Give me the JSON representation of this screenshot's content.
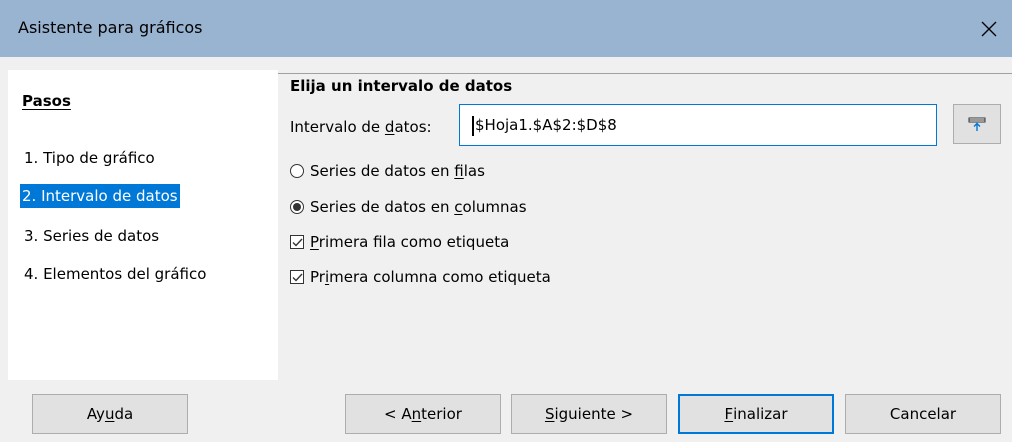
{
  "window": {
    "title": "Asistente para gráficos",
    "close_icon": "close-icon"
  },
  "steps": {
    "heading": "Pasos",
    "items": [
      {
        "label": "1. Tipo de gráfico",
        "selected": false
      },
      {
        "label": "2. Intervalo de datos",
        "selected": true
      },
      {
        "label": "3. Series de datos",
        "selected": false
      },
      {
        "label": "4. Elementos del gráfico",
        "selected": false
      }
    ]
  },
  "main": {
    "section_title": "Elija un intervalo de datos",
    "range_label_pre": "Intervalo de ",
    "range_label_mnemonic": "d",
    "range_label_post": "atos:",
    "range_value": "$Hoja1.$A$2:$D$8",
    "shrink_icon": "shrink-icon",
    "options": [
      {
        "type": "radio",
        "checked": false,
        "pre": "Series de datos en ",
        "mnemonic": "f",
        "post": "ilas"
      },
      {
        "type": "radio",
        "checked": true,
        "pre": "Series de datos en ",
        "mnemonic": "c",
        "post": "olumnas"
      },
      {
        "type": "checkbox",
        "checked": true,
        "pre": "",
        "mnemonic": "P",
        "post": "rimera fila como etiqueta"
      },
      {
        "type": "checkbox",
        "checked": true,
        "pre": "Pr",
        "mnemonic": "i",
        "post": "mera columna como etiqueta"
      }
    ]
  },
  "buttons": {
    "help": {
      "pre": "Ay",
      "mnemonic": "u",
      "post": "da"
    },
    "back": {
      "pre": "< A",
      "mnemonic": "n",
      "post": "terior"
    },
    "next": {
      "pre": "",
      "mnemonic": "S",
      "post": "iguiente >"
    },
    "finish": {
      "pre": "",
      "mnemonic": "F",
      "post": "inalizar"
    },
    "cancel": {
      "pre": "Cancelar",
      "mnemonic": "",
      "post": ""
    }
  },
  "colors": {
    "titlebar": "#99b4d1",
    "selection": "#0078d7"
  }
}
